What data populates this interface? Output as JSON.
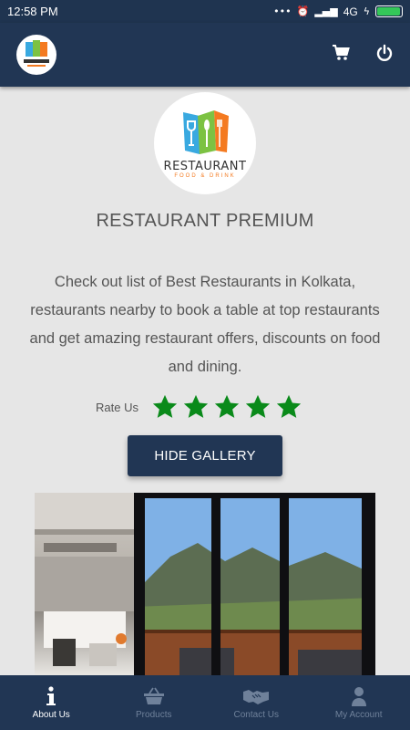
{
  "status_bar": {
    "time": "12:58 PM",
    "network": "4G"
  },
  "brand": {
    "name": "RESTAURANT",
    "tagline": "FOOD & DRINK"
  },
  "app_bar": {
    "cart_icon": "cart-icon",
    "power_icon": "power-icon"
  },
  "main": {
    "title": "RESTAURANT PREMIUM",
    "description": "Check out list of Best Restaurants in Kolkata, restaurants nearby to book a table at top restaurants and get amazing restaurant offers, discounts on food and dining.",
    "rate_label": "Rate Us",
    "rating": 5,
    "rating_max": 5,
    "gallery_button": "HIDE GALLERY"
  },
  "bottom_nav": {
    "items": [
      {
        "label": "About Us",
        "icon": "info-icon",
        "active": true
      },
      {
        "label": "Products",
        "icon": "basket-icon",
        "active": false
      },
      {
        "label": "Contact Us",
        "icon": "handshake-icon",
        "active": false
      },
      {
        "label": "My Account",
        "icon": "person-icon",
        "active": false
      }
    ]
  },
  "colors": {
    "primary": "#213654",
    "star": "#0a8a1a",
    "background": "#e6e6e6"
  }
}
